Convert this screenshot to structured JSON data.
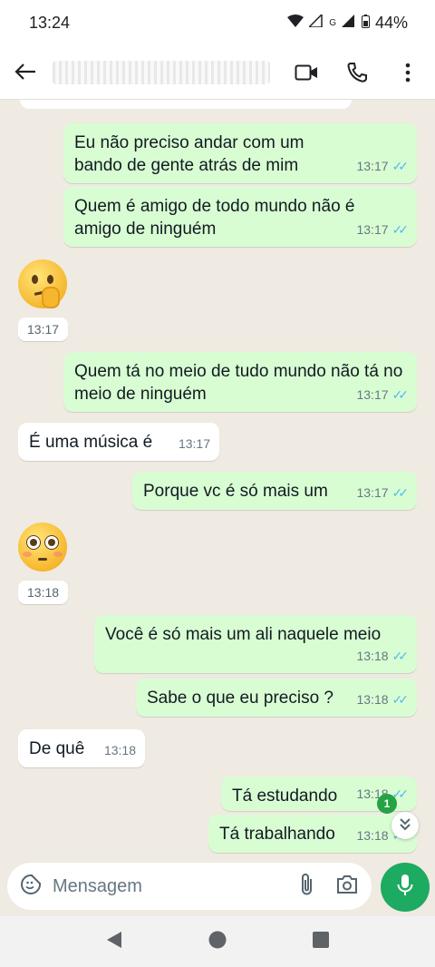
{
  "status_bar": {
    "time": "13:24",
    "battery": "44%",
    "network": "G"
  },
  "chat": {
    "messages": [
      {
        "type": "out",
        "text": "Eu não preciso andar com um bando de gente atrás de mim",
        "time": "13:17"
      },
      {
        "type": "out",
        "text": "Quem é amigo de todo mundo não é amigo de ninguém",
        "time": "13:17"
      },
      {
        "type": "in_emoji",
        "emoji": "thinking-face",
        "time": "13:17"
      },
      {
        "type": "out",
        "text": "Quem tá no meio de tudo mundo não tá no meio de ninguém",
        "time": "13:17"
      },
      {
        "type": "in",
        "text": "É uma música é",
        "time": "13:17"
      },
      {
        "type": "out",
        "text": "Porque vc é só mais um",
        "time": "13:17"
      },
      {
        "type": "in_emoji",
        "emoji": "flushed-face",
        "time": "13:18"
      },
      {
        "type": "out",
        "text": "Você é só mais um ali naquele meio",
        "time": "13:18"
      },
      {
        "type": "out",
        "text": "Sabe o que eu preciso ?",
        "time": "13:18"
      },
      {
        "type": "in",
        "text": "De quê",
        "time": "13:18"
      },
      {
        "type": "out",
        "text": "Tá estudando",
        "time": "13:18"
      },
      {
        "type": "out",
        "text": "Tá trabalhando",
        "time": "13:18"
      }
    ],
    "unread_badge": "1"
  },
  "input": {
    "placeholder": "Mensagem"
  },
  "colors": {
    "outgoing": "#d9fdd3",
    "incoming": "#ffffff",
    "accent": "#1daa61",
    "read_ticks": "#53bdeb"
  }
}
